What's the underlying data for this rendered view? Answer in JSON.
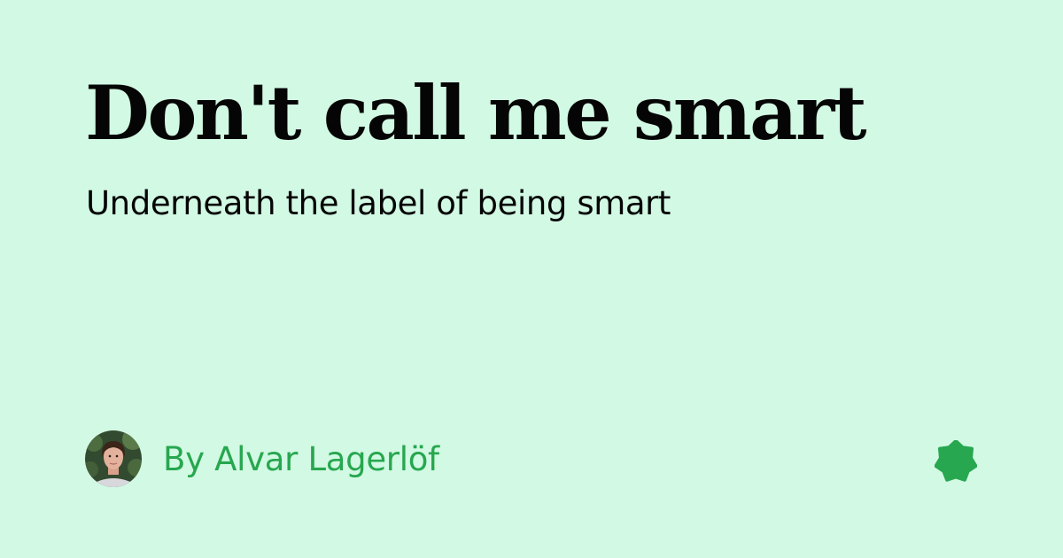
{
  "post": {
    "title": "Don't call me smart",
    "subtitle": "Underneath the label of being smart"
  },
  "author": {
    "byline": "By Alvar Lagerlöf",
    "avatar_icon": "author-portrait"
  },
  "brand": {
    "icon": "star-badge-icon"
  },
  "colors": {
    "background": "#d2f9e4",
    "text": "#050505",
    "accent": "#27a74f"
  }
}
